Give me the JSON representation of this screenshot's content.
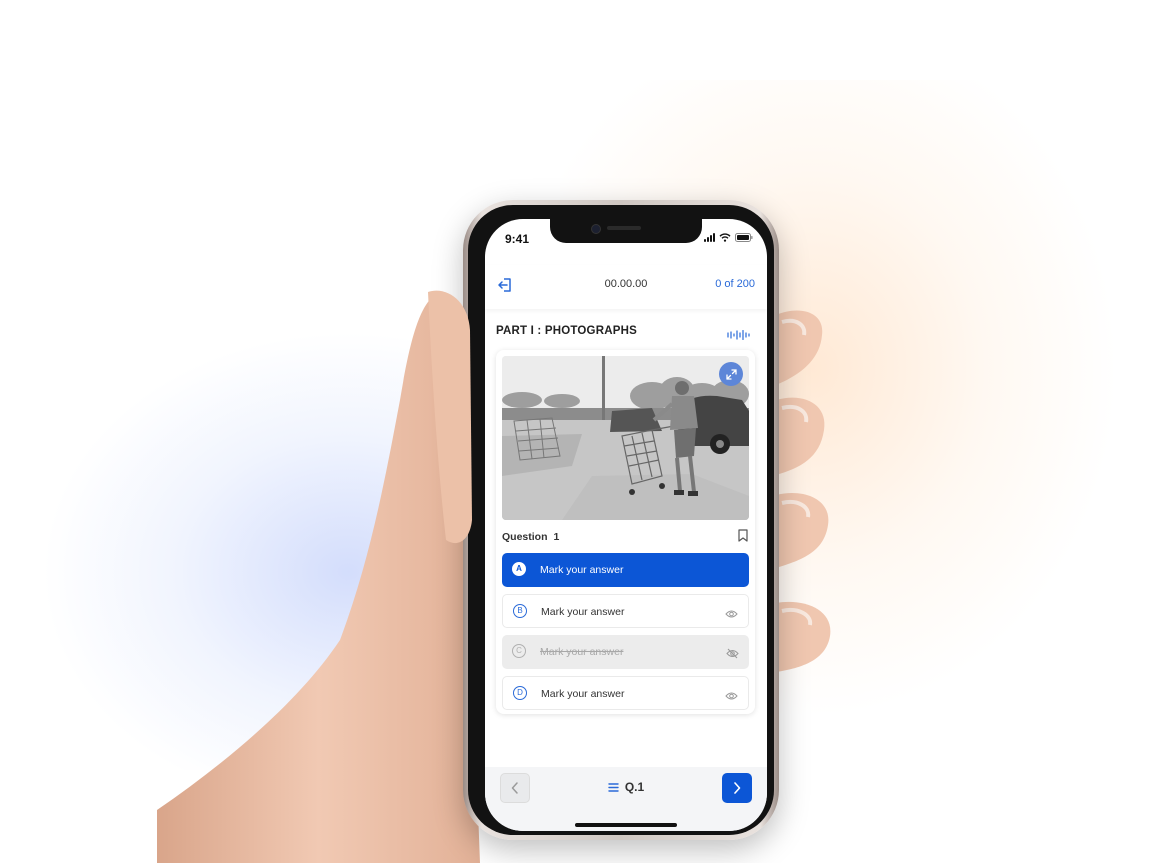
{
  "status_bar": {
    "time": "9:41"
  },
  "header": {
    "timer": "00.00.00",
    "progress": "0 of 200"
  },
  "section": {
    "title": "PART I : PHOTOGRAPHS"
  },
  "question": {
    "label": "Question",
    "number": "1",
    "options": [
      {
        "letter": "A",
        "text": "Mark your answer",
        "state": "selected"
      },
      {
        "letter": "B",
        "text": "Mark your answer",
        "state": "normal"
      },
      {
        "letter": "C",
        "text": "Mark your answer",
        "state": "eliminated"
      },
      {
        "letter": "D",
        "text": "Mark your answer",
        "state": "normal"
      }
    ]
  },
  "footer": {
    "current": "Q.1"
  },
  "colors": {
    "accent": "#0c56d6",
    "accent_light": "#5d86d8",
    "link": "#2a6ad8"
  },
  "icons": [
    "exit-icon",
    "audio-wave-icon",
    "expand-icon",
    "bookmark-icon",
    "eye-icon",
    "eye-off-icon",
    "chevron-left-icon",
    "list-icon",
    "chevron-right-icon"
  ]
}
